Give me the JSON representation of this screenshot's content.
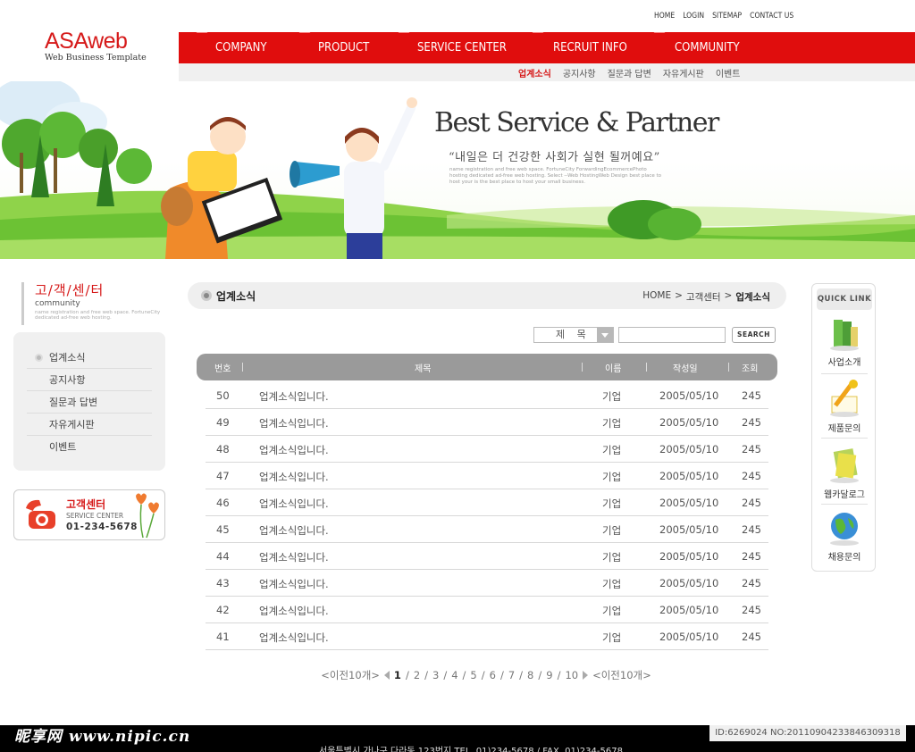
{
  "brand": {
    "title": "ASAweb",
    "subtitle": "Web Business Template"
  },
  "utility": [
    "HOME",
    "LOGIN",
    "SITEMAP",
    "CONTACT US"
  ],
  "gnb": [
    "COMPANY",
    "PRODUCT",
    "SERVICE CENTER",
    "RECRUIT INFO",
    "COMMUNITY"
  ],
  "subnav": {
    "active": "업계소식",
    "items": [
      "공지사항",
      "질문과 답변",
      "자유게시판",
      "이벤트"
    ]
  },
  "hero": {
    "title": "Best Service & Partner",
    "quote": "“내일은 더 건강한 사회가 실현 될꺼예요”",
    "small": "name registration and free web space. FortuneCity ForwardingEcommercePhoto hosting dedicated ad-free web hosting. Select --Web HostingWeb Design best place to host your is the best place to host your small business."
  },
  "lnb": {
    "title_kor": "고/객/센/터",
    "title_eng": "community",
    "desc": "name registration and free web space. FortuneCity dedicated ad-free web hosting.",
    "items": [
      "업계소식",
      "공지사항",
      "질문과 답변",
      "자유게시판",
      "이벤트"
    ]
  },
  "cs": {
    "title": "고객센터",
    "sub": "SERVICE CENTER",
    "phone": "01-234-5678"
  },
  "page": {
    "title": "업계소식",
    "breadcrumb": [
      "HOME",
      "고객센터",
      "업계소식"
    ]
  },
  "search": {
    "field": "제 목",
    "button": "SEARCH"
  },
  "table": {
    "headers": [
      "번호",
      "제목",
      "이름",
      "작성일",
      "조회"
    ],
    "rows": [
      [
        "50",
        "업계소식입니다.",
        "기업",
        "2005/05/10",
        "245"
      ],
      [
        "49",
        "업계소식입니다.",
        "기업",
        "2005/05/10",
        "245"
      ],
      [
        "48",
        "업계소식입니다.",
        "기업",
        "2005/05/10",
        "245"
      ],
      [
        "47",
        "업계소식입니다.",
        "기업",
        "2005/05/10",
        "245"
      ],
      [
        "46",
        "업계소식입니다.",
        "기업",
        "2005/05/10",
        "245"
      ],
      [
        "45",
        "업계소식입니다.",
        "기업",
        "2005/05/10",
        "245"
      ],
      [
        "44",
        "업계소식입니다.",
        "기업",
        "2005/05/10",
        "245"
      ],
      [
        "43",
        "업계소식입니다.",
        "기업",
        "2005/05/10",
        "245"
      ],
      [
        "42",
        "업계소식입니다.",
        "기업",
        "2005/05/10",
        "245"
      ],
      [
        "41",
        "업계소식입니다.",
        "기업",
        "2005/05/10",
        "245"
      ]
    ]
  },
  "pager": {
    "prev": "<이전10개>",
    "next": "<이전10개>",
    "pages": [
      "1",
      "2",
      "3",
      "4",
      "5",
      "6",
      "7",
      "8",
      "9",
      "10"
    ],
    "current": "1"
  },
  "quick": {
    "head": "QUICK LINK",
    "items": [
      "사업소개",
      "제품문의",
      "웹카달로그",
      "채용문의"
    ]
  },
  "footer": {
    "address": "서울특별시 가나구 다라동 123번지 TEL. 01)234-5678  /  FAX. 01)234-5678"
  },
  "watermark": {
    "left": "昵享网 www.nipic.cn",
    "right": "ID:6269024 NO:20110904233846309318"
  },
  "colors": {
    "accent": "#e00d0d",
    "header_gray": "#9a9a9a"
  }
}
